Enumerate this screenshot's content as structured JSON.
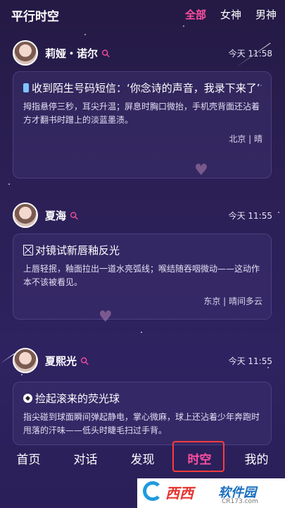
{
  "header": {
    "title": "平行时空",
    "tabs": [
      {
        "label": "全部",
        "active": true
      },
      {
        "label": "女神",
        "active": false
      },
      {
        "label": "男神",
        "active": false
      }
    ]
  },
  "posts": [
    {
      "username": "莉娅・诺尔",
      "gender_icon": "female-icon",
      "time": "今天 11:58",
      "title_icon": "phone-icon",
      "title": "收到陌生号码短信：‘你念诗的声音，我录下来了’",
      "body": "拇指悬停三秒，耳尖升温；屏息时胸口微抬，手机壳背面还沾着方才翻书时蹭上的淡蓝墨渍。",
      "footer": "北京 | 晴"
    },
    {
      "username": "夏海",
      "gender_icon": "female-icon",
      "time": "今天 11:55",
      "title_icon": "box-icon",
      "title": "对镜试新唇釉反光",
      "body": "上唇轻抿，釉面拉出一道水亮弧线；喉结随吞咽微动——这动作本不该被看见。",
      "footer": "东京 | 晴间多云"
    },
    {
      "username": "夏熙光",
      "gender_icon": "female-icon",
      "time": "今天 11:55",
      "title_icon": "soccer-ball-icon",
      "title": "捡起滚来的荧光球",
      "body": "指尖碰到球面瞬间弹起静电，掌心微麻，球上还沾着少年奔跑时甩落的汗味——低头时睫毛扫过手背。",
      "footer": ""
    }
  ],
  "bottom_nav": [
    {
      "label": "首页",
      "active": false
    },
    {
      "label": "对话",
      "active": false
    },
    {
      "label": "发现",
      "active": false
    },
    {
      "label": "时空",
      "active": true
    },
    {
      "label": "我的",
      "active": false
    }
  ],
  "watermark": {
    "brand": "西西",
    "brand2": "软件园",
    "url": "CR173.com"
  },
  "colors": {
    "accent": "#ff4fa0",
    "highlight_box": "#ff3b3b",
    "background": "#2b1f55"
  }
}
